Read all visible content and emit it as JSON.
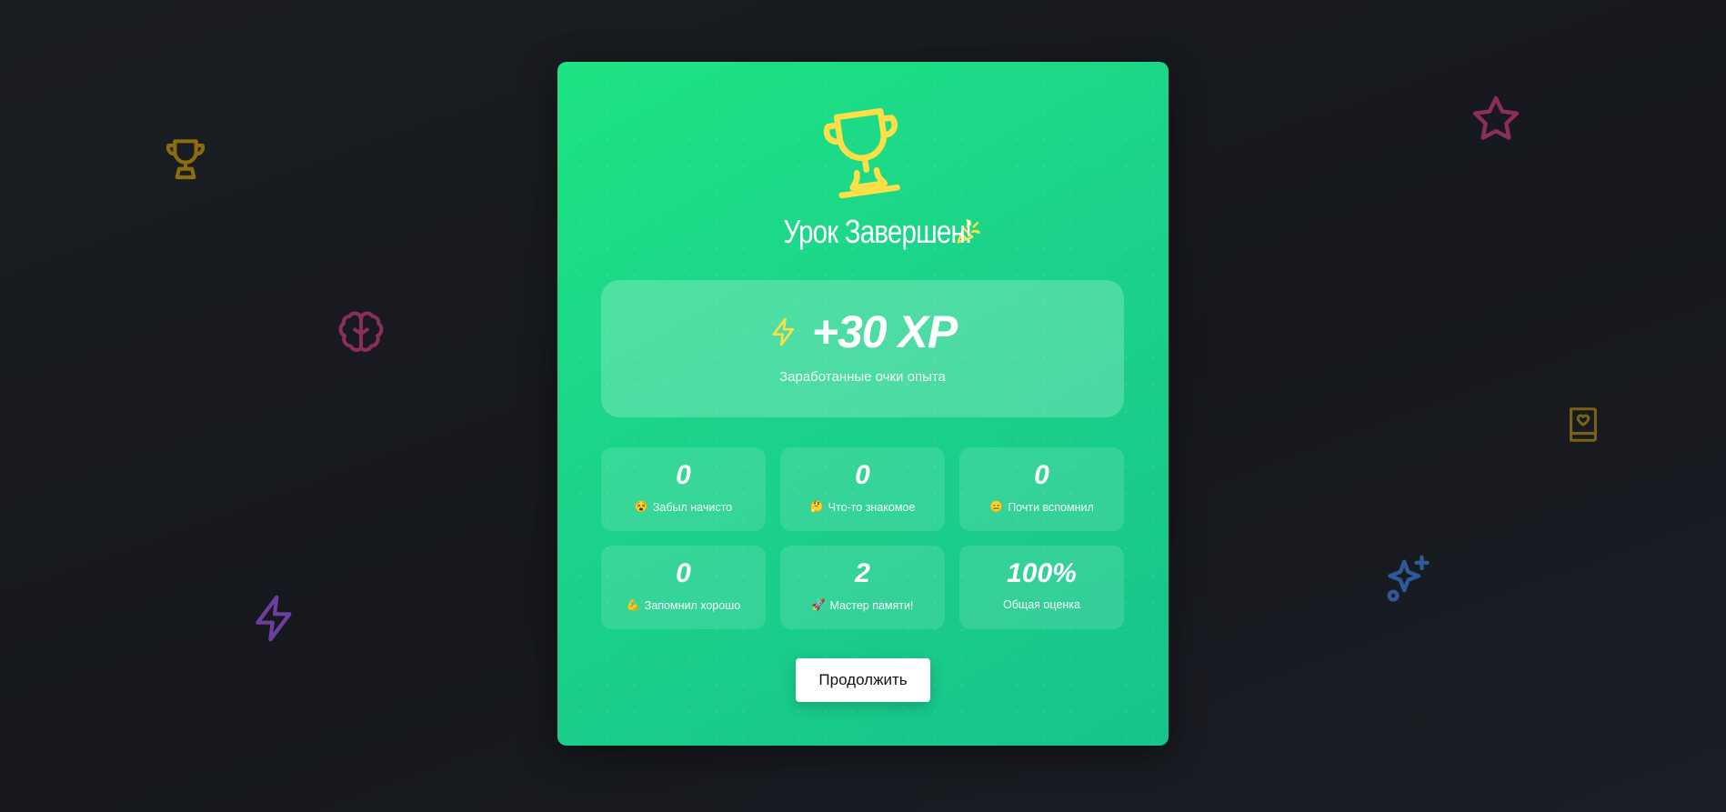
{
  "lesson_complete": {
    "title": "Урок Завершен!",
    "xp": {
      "value": "+30 XP",
      "label": "Заработанные очки опыта"
    },
    "stats": [
      {
        "value": "0",
        "emoji": "😵",
        "label": "Забыл начисто"
      },
      {
        "value": "0",
        "emoji": "🤔",
        "label": "Что-то знакомое"
      },
      {
        "value": "0",
        "emoji": "😑",
        "label": "Почти вспомнил"
      },
      {
        "value": "0",
        "emoji": "💪",
        "label": "Запомнил хорошо"
      },
      {
        "value": "2",
        "emoji": "🚀",
        "label": "Мастер памяти!"
      },
      {
        "value": "100%",
        "emoji": "",
        "label": "Общая оценка"
      }
    ],
    "continue_label": "Продолжить"
  },
  "icons": {
    "main": "trophy-icon",
    "title": "party-popper-icon",
    "xp": "lightning-icon",
    "background": [
      "trophy-icon",
      "brain-icon",
      "lightning-icon",
      "star-icon",
      "book-heart-icon",
      "sparkles-icon"
    ]
  },
  "colors": {
    "page_background": "#181a1f",
    "card_gradient_start": "#1de383",
    "card_gradient_end": "#17c48b",
    "trophy": "#fde047",
    "button_background": "#ffffff",
    "button_text": "#111111"
  }
}
